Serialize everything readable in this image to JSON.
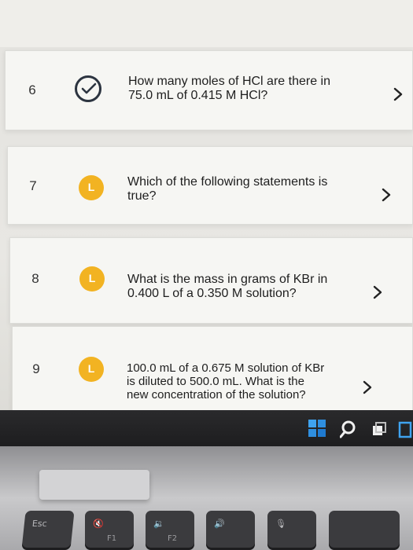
{
  "questions": [
    {
      "number": "6",
      "status": "completed",
      "status_icon": "checkmark-circle-icon",
      "text_line1": "How many moles of HCl are there in",
      "text_line2": "75.0 mL of 0.415 M HCl?"
    },
    {
      "number": "7",
      "status": "in-progress",
      "status_glyph": "L",
      "text_line1": "Which of the following statements is",
      "text_line2": "true?"
    },
    {
      "number": "8",
      "status": "in-progress",
      "status_glyph": "L",
      "text_line1": "What is the mass in grams of KBr in",
      "text_line2": "0.400 L of a 0.350 M solution?"
    },
    {
      "number": "9",
      "status": "in-progress",
      "status_glyph": "L",
      "text_line1": "100.0 mL of a 0.675 M solution of KBr",
      "text_line2": "is diluted to 500.0 mL. What is the",
      "text_line3": "new concentration of the solution?"
    }
  ],
  "taskbar": {
    "icons": [
      "windows-start-icon",
      "search-icon",
      "task-view-icon",
      "widgets-icon"
    ]
  },
  "keyboard": {
    "keys": [
      {
        "label": "Esc",
        "sub": ""
      },
      {
        "label": "🔇",
        "sub": "F1"
      },
      {
        "label": "🔉",
        "sub": "F2"
      },
      {
        "label": "🔊",
        "sub": ""
      },
      {
        "label": "🎙",
        "sub": ""
      }
    ]
  },
  "colors": {
    "card_bg": "#f6f6f3",
    "pending_badge": "#f2b322",
    "check_ring": "#2c3440",
    "taskbar": "#1f1f21",
    "windows_blue": "#2f8fe0"
  }
}
